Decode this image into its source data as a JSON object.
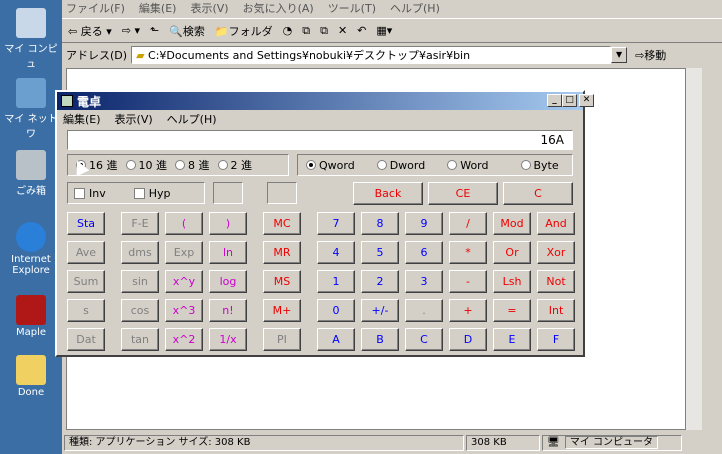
{
  "desktop": {
    "icons": [
      "マイ コンピュ",
      "マイ ネットワ",
      "ごみ箱",
      "Internet Explore",
      "Maple",
      "Done"
    ]
  },
  "explorer": {
    "menu": [
      "ファイル(F)",
      "編集(E)",
      "表示(V)",
      "お気に入り(A)",
      "ツール(T)",
      "ヘルプ(H)"
    ],
    "toolbar": {
      "back": "戻る",
      "search": "検索",
      "folders": "フォルダ"
    },
    "address_label": "アドレス(D)",
    "address": "C:¥Documents and Settings¥nobuki¥デスクトップ¥asir¥bin",
    "go": "移動",
    "status": {
      "type": "種類: アプリケーション サイズ: 308 KB",
      "size": "308 KB",
      "location": "マイ コンピュータ"
    }
  },
  "calc": {
    "title": "電卓",
    "menu": [
      "編集(E)",
      "表示(V)",
      "ヘルプ(H)"
    ],
    "display": "16A",
    "bases": [
      "16 進",
      "10 進",
      "8 進",
      "2 進"
    ],
    "words": [
      "Qword",
      "Dword",
      "Word",
      "Byte"
    ],
    "inv": "Inv",
    "hyp": "Hyp",
    "ctrl": [
      "Back",
      "CE",
      "C"
    ],
    "sci": [
      "Sta",
      "F-E",
      "(",
      ")",
      "Ave",
      "dms",
      "Exp",
      "ln",
      "Sum",
      "sin",
      "x^y",
      "log",
      "s",
      "cos",
      "x^3",
      "n!",
      "Dat",
      "tan",
      "x^2",
      "1/x"
    ],
    "mem": [
      "MC",
      "MR",
      "MS",
      "M+",
      "PI"
    ],
    "pad": [
      "7",
      "8",
      "9",
      "/",
      "Mod",
      "And",
      "4",
      "5",
      "6",
      "*",
      "Or",
      "Xor",
      "1",
      "2",
      "3",
      "-",
      "Lsh",
      "Not",
      "0",
      "+/-",
      ".",
      "+",
      "=",
      "Int",
      "A",
      "B",
      "C",
      "D",
      "E",
      "F"
    ]
  }
}
